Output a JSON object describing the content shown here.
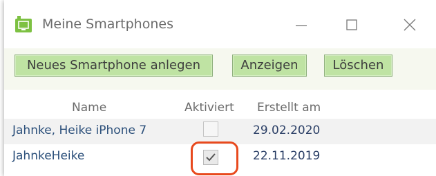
{
  "window": {
    "title": "Meine Smartphones",
    "icon": "smartphone-app-icon",
    "accent_color": "#7dc142"
  },
  "toolbar": {
    "new_label": "Neues Smartphone anlegen",
    "show_label": "Anzeigen",
    "delete_label": "Löschen",
    "button_color": "#bfe3a3"
  },
  "table": {
    "columns": [
      "Name",
      "Aktiviert",
      "Erstellt am"
    ],
    "rows": [
      {
        "name": "Jahnke, Heike iPhone 7",
        "activated": false,
        "created": "29.02.2020"
      },
      {
        "name": "JahnkeHeike",
        "activated": true,
        "created": "22.11.2019"
      }
    ]
  },
  "annotation": {
    "highlight_color": "#e8491d",
    "target": "activated-checkbox-row-2"
  }
}
